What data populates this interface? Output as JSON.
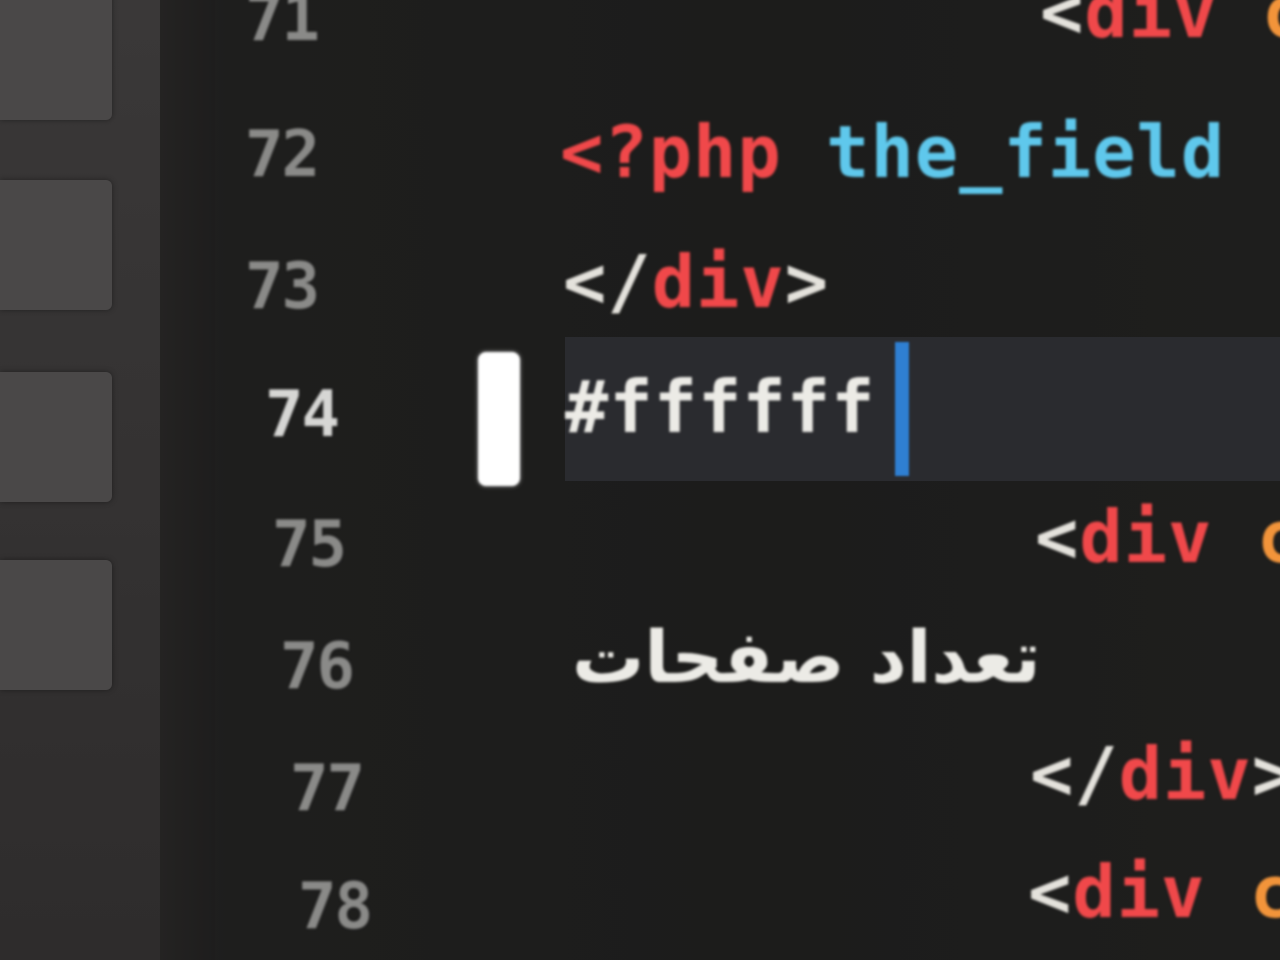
{
  "editor": {
    "swatch_color": "#ffffff",
    "cursor_color": "#2f7fd2",
    "colors": {
      "tag": "#f0484a",
      "function": "#5fc8ec",
      "attribute": "#f2943a",
      "punctuation": "#e4e2dc"
    },
    "lines": [
      {
        "number": "71",
        "code": {
          "open": "<",
          "tag": "div",
          "attr": "c"
        }
      },
      {
        "number": "72",
        "code": {
          "php_open": "<?php",
          "fn": "the_field"
        }
      },
      {
        "number": "73",
        "code": {
          "open": "</",
          "tag": "div",
          "close": ">"
        }
      },
      {
        "number": "74",
        "code": {
          "text": "#ffffff"
        }
      },
      {
        "number": "75",
        "code": {
          "open": "<",
          "tag": "div",
          "attr": "c"
        }
      },
      {
        "number": "76",
        "code": {
          "text": "تعداد صفحات"
        }
      },
      {
        "number": "77",
        "code": {
          "open": "</",
          "tag": "div",
          "close": ">"
        }
      },
      {
        "number": "78",
        "code": {
          "open": "<",
          "tag": "div",
          "attr": "c"
        }
      }
    ],
    "active_line": "74"
  }
}
